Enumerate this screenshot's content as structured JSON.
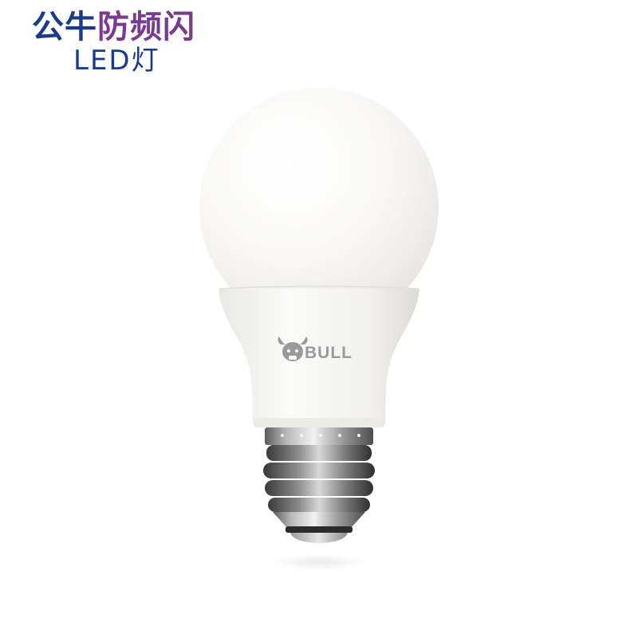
{
  "headline": {
    "brand": "公牛",
    "feature": "防频闪",
    "product_type": "LED灯"
  },
  "bulb": {
    "logo_text": "BULL"
  },
  "colors": {
    "brand_blue": "#1a3a8f",
    "feature_purple": "#7a3a8f",
    "background": "#ffffff"
  }
}
